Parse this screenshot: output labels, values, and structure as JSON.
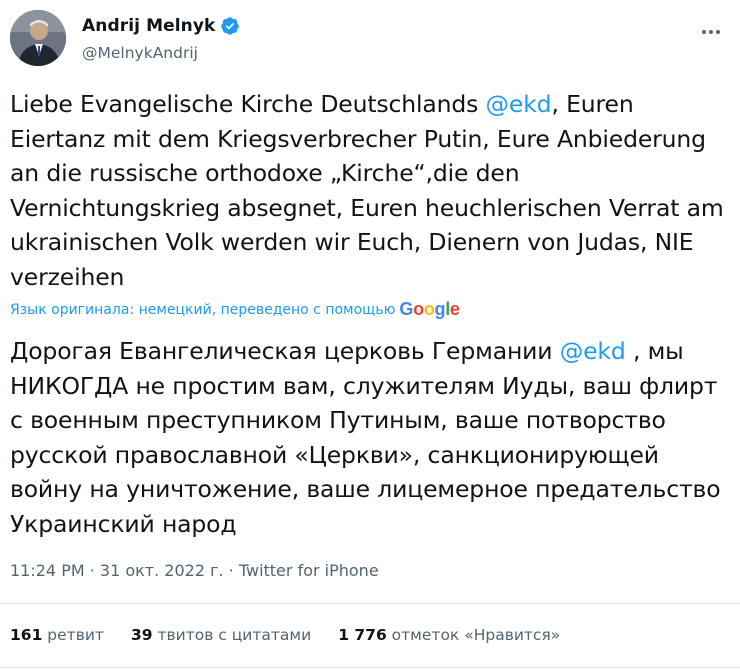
{
  "author": {
    "name": "Andrij Melnyk",
    "handle": "@MelnykAndrij"
  },
  "colors": {
    "accent": "#1d9bf0",
    "text": "#0f1419",
    "muted": "#536471"
  },
  "tweet": {
    "original": {
      "before_mention": "Liebe Evangelische Kirche Deutschlands ",
      "mention": "@ekd",
      "after_mention": ", Euren Eiertanz mit dem Kriegsverbrecher Putin, Eure Anbiederung an die russische orthodoxe „Kirche“,die den Vernichtungskrieg absegnet, Euren heuchlerischen Verrat am ukrainischen Volk werden wir Euch, Dienern von Judas, NIE verzeihen"
    },
    "translation_note": "Язык оригинала: немецкий, переведено с помощью",
    "translation_provider": "Google",
    "translated": {
      "before_mention": "Дорогая Евангелическая церковь Германии ",
      "mention": "@ekd",
      "after_mention": " , мы НИКОГДА не простим вам, служителям Иуды, ваш флирт с военным преступником Путиным, ваше потворство русской православной «Церкви», санкционирующей войну на уничтожение, ваше лицемерное предательство Украинский народ"
    },
    "meta": "11:24 PM · 31 окт. 2022 г. · Twitter for iPhone"
  },
  "stats": {
    "retweets_count": "161",
    "retweets_label": "ретвит",
    "quotes_count": "39",
    "quotes_label": "твитов с цитатами",
    "likes_count": "1 776",
    "likes_label": "отметок «Нравится»"
  }
}
